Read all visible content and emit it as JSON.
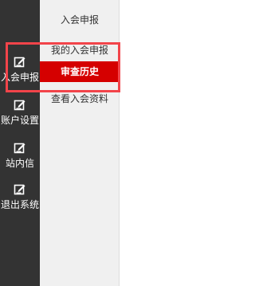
{
  "rail": {
    "items": [
      {
        "label": "入会申报",
        "icon": "edit-icon",
        "active": true
      },
      {
        "label": "账户设置",
        "icon": "edit-icon",
        "active": false
      },
      {
        "label": "站内信",
        "icon": "edit-icon",
        "active": false
      },
      {
        "label": "退出系统",
        "icon": "edit-icon",
        "active": false
      }
    ]
  },
  "submenu": {
    "title": "入会申报",
    "items": [
      {
        "label": "我的入会申报",
        "active": false
      },
      {
        "label": "审查历史",
        "active": true
      },
      {
        "label": "查看入会资料",
        "active": false
      }
    ]
  },
  "colors": {
    "rail_bg": "#333333",
    "submenu_bg": "#f0f0f0",
    "active_bg": "#d50000",
    "highlight_border": "#f2444a"
  }
}
